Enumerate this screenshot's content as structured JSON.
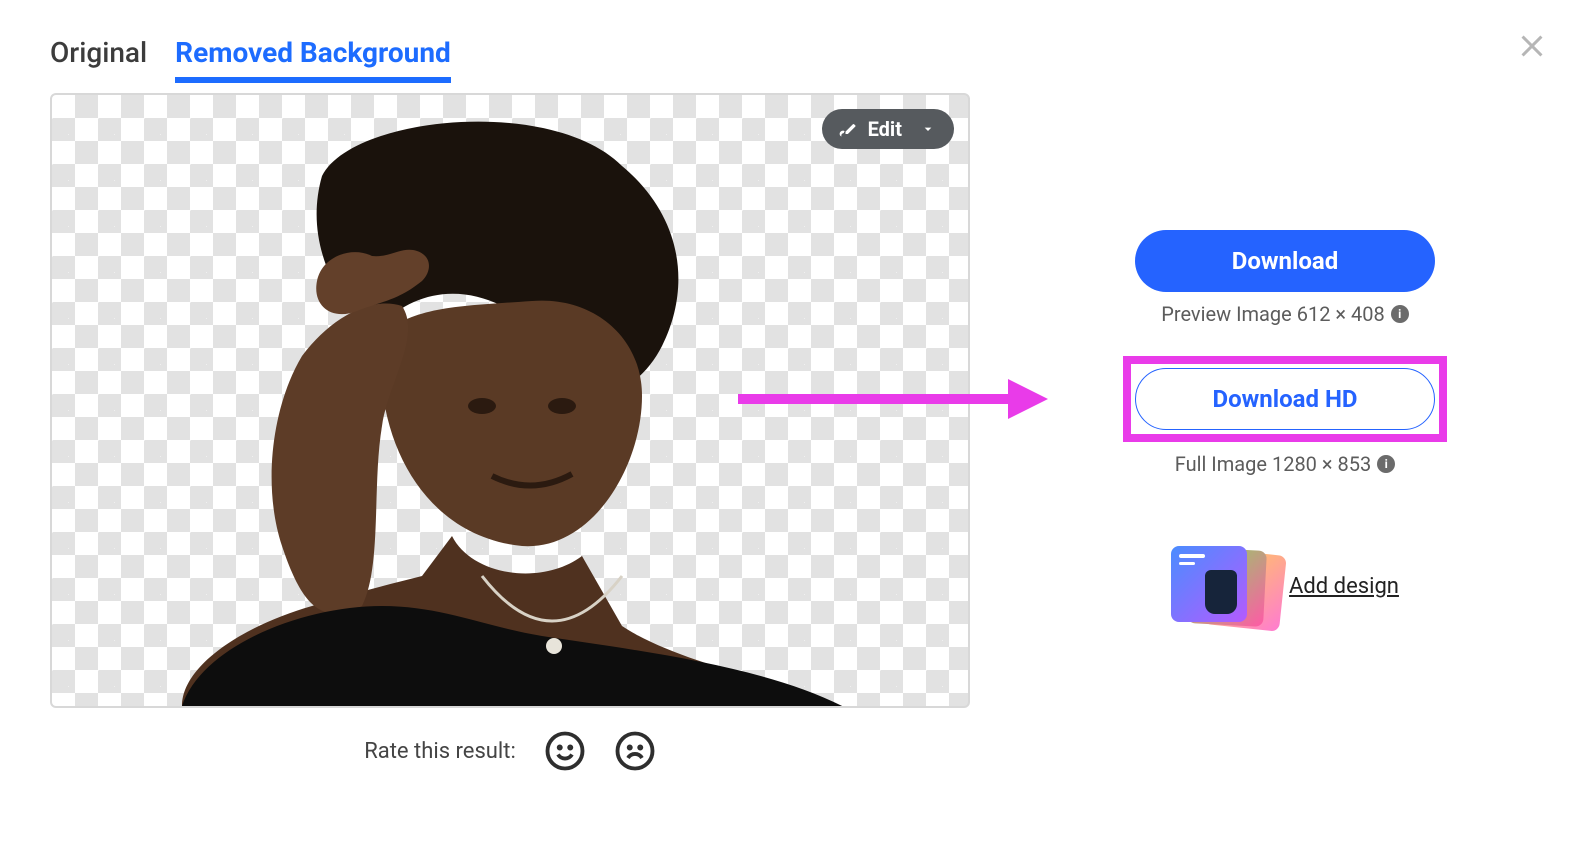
{
  "tabs": {
    "original": "Original",
    "removed": "Removed Background"
  },
  "edit": {
    "label": "Edit"
  },
  "rate": {
    "label": "Rate this result:"
  },
  "download": {
    "primary_label": "Download",
    "preview_caption": "Preview Image 612 × 408",
    "hd_label": "Download HD",
    "full_caption": "Full Image 1280 × 853"
  },
  "add_design": {
    "label": "Add design"
  },
  "info_glyph": "i"
}
